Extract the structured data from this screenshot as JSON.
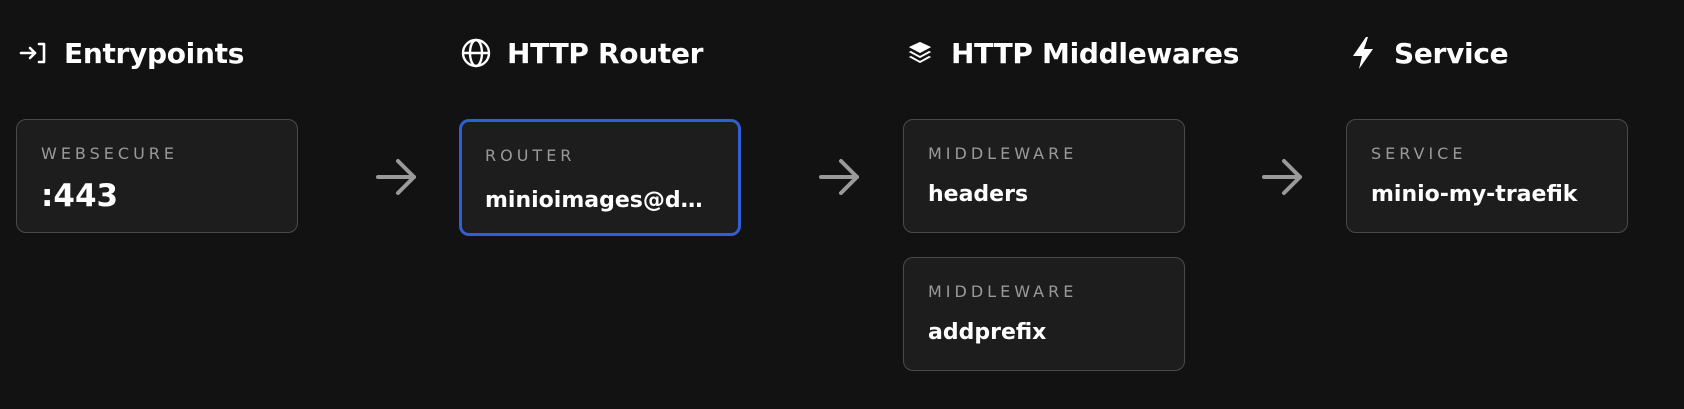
{
  "columns": {
    "entrypoints": {
      "title": "Entrypoints",
      "icon": "entrypoint-arrow-icon",
      "cards": [
        {
          "label": "WEBSECURE",
          "value": ":443"
        }
      ]
    },
    "router": {
      "title": "HTTP Router",
      "icon": "globe-icon",
      "cards": [
        {
          "label": "ROUTER",
          "value": "minioimages@doc..."
        }
      ]
    },
    "middlewares": {
      "title": "HTTP Middlewares",
      "icon": "layers-icon",
      "cards": [
        {
          "label": "MIDDLEWARE",
          "value": "headers"
        },
        {
          "label": "MIDDLEWARE",
          "value": "addprefix"
        }
      ]
    },
    "service": {
      "title": "Service",
      "icon": "lightning-icon",
      "cards": [
        {
          "label": "SERVICE",
          "value": "minio-my-traefik"
        }
      ]
    }
  },
  "colors": {
    "background": "#121212",
    "card_background": "#1d1d1d",
    "card_border": "#4a4a4a",
    "selected_border": "#2f5fd6",
    "label_text": "#9a9a9a",
    "arrow": "#9a9a9a"
  }
}
